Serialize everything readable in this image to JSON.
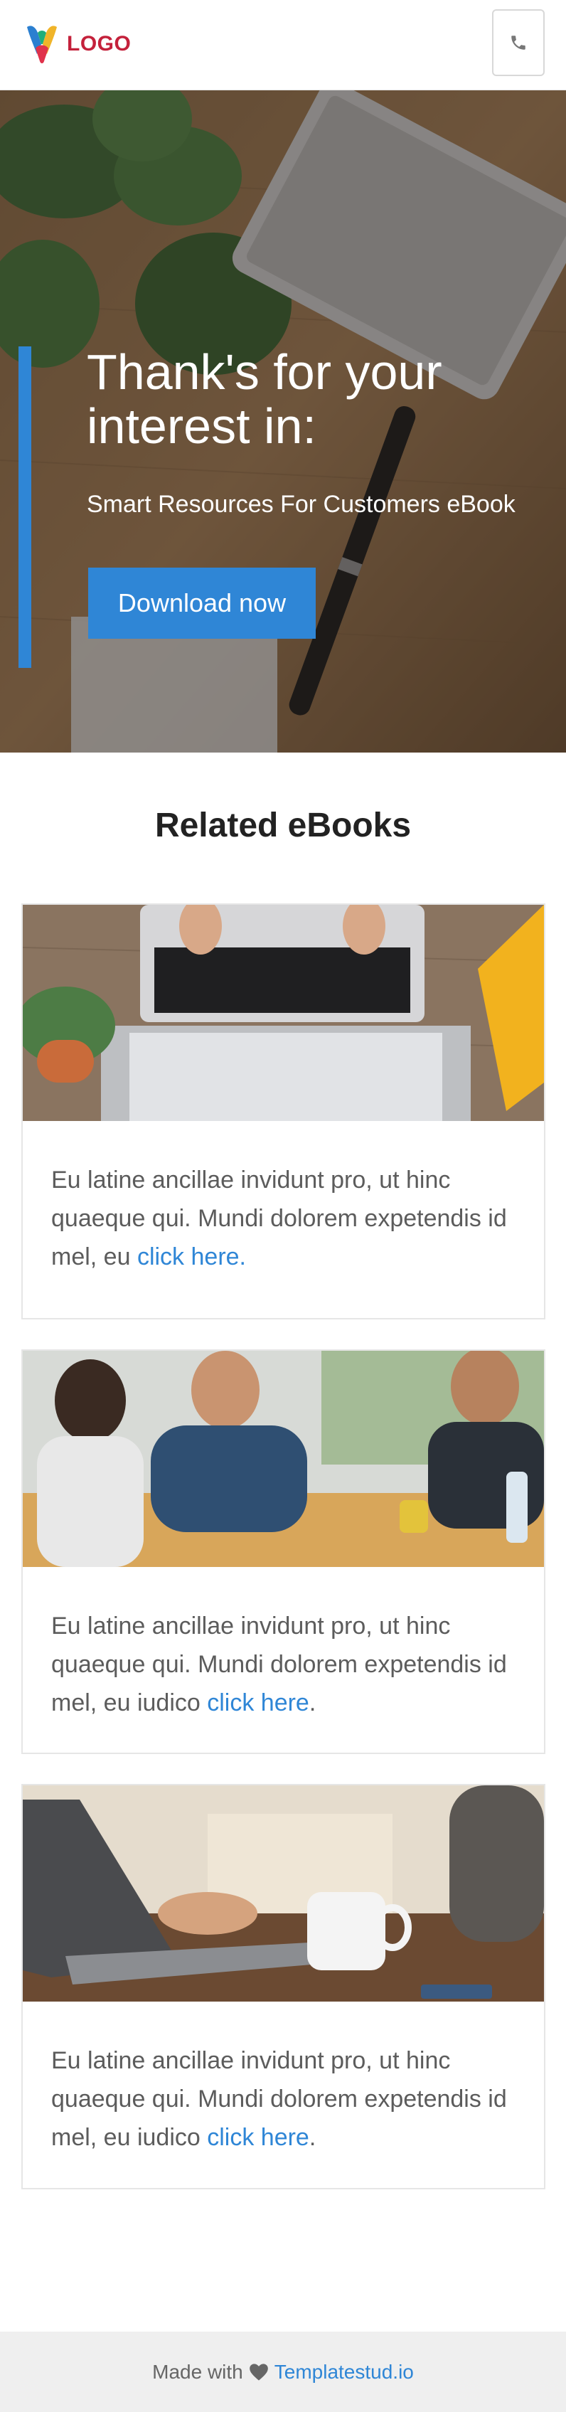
{
  "header": {
    "logo_text": "LOGO",
    "phone_icon": "phone-icon"
  },
  "hero": {
    "title": "Thank's for your interest in:",
    "subtitle": "Smart Resources For Customers eBook",
    "button_label": "Download now",
    "accent_color": "#2f86d6"
  },
  "related": {
    "title": "Related eBooks",
    "cards": [
      {
        "text": "Eu latine ancillae invidunt pro, ut hinc quaeque qui. Mundi dolorem expetendis id mel, eu ",
        "link": "click here."
      },
      {
        "text": "Eu latine ancillae invidunt pro, ut hinc quaeque qui. Mundi dolorem expetendis id mel, eu iudico ",
        "link": "click here",
        "after": "."
      },
      {
        "text": "Eu latine ancillae invidunt pro, ut hinc quaeque qui. Mundi dolorem expetendis id mel, eu iudico ",
        "link": "click here",
        "after": "."
      }
    ]
  },
  "footer": {
    "made_with": "Made with",
    "heart_icon": "heart-icon",
    "link": "Templatestud.io"
  }
}
